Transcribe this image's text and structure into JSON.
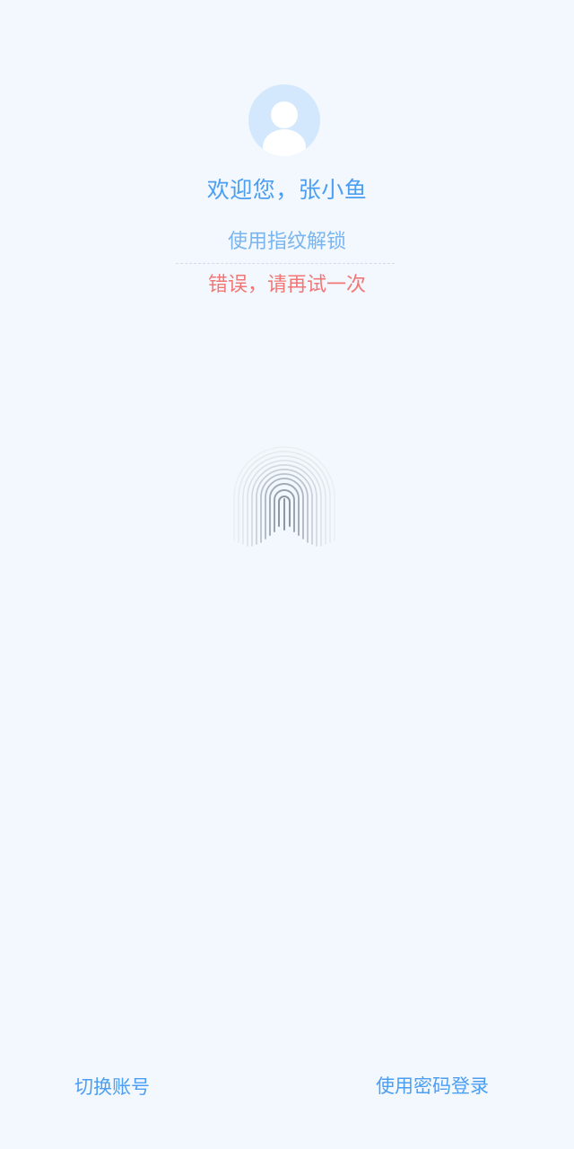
{
  "user": {
    "avatar_icon": "user-avatar-icon",
    "welcome_text": "欢迎您，张小鱼"
  },
  "auth": {
    "hint_text": "使用指纹解锁",
    "error_text": "错误，请再试一次",
    "fingerprint_icon": "fingerprint-icon"
  },
  "footer": {
    "switch_account_label": "切换账号",
    "password_login_label": "使用密码登录"
  },
  "colors": {
    "background": "#f2f8fd",
    "accent": "#4b9ef2",
    "hint": "#7ab5ef",
    "error": "#f17777",
    "avatar_bg": "#d4e8fd"
  }
}
